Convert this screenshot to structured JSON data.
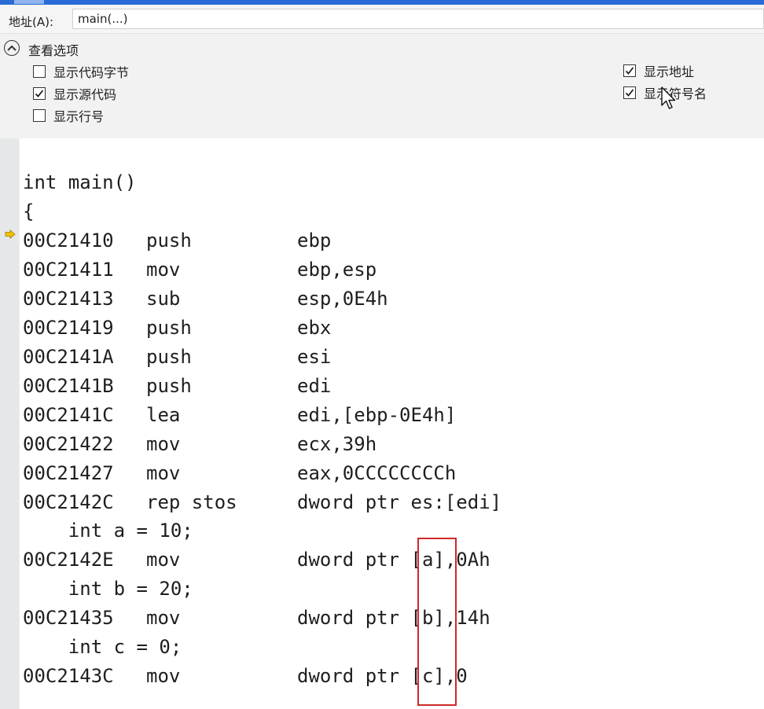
{
  "address": {
    "label": "地址(A):",
    "value": "main(...)"
  },
  "view_options": {
    "title": "查看选项",
    "left": [
      {
        "label": "显示代码字节",
        "checked": false
      },
      {
        "label": "显示源代码",
        "checked": true
      },
      {
        "label": "显示行号",
        "checked": false
      }
    ],
    "right": [
      {
        "label": "显示地址",
        "checked": true
      },
      {
        "label": "显示符号名",
        "checked": true
      }
    ]
  },
  "code": {
    "source_header": [
      "int main()",
      "{"
    ],
    "block1": [
      {
        "addr": "00C21410",
        "op": "push",
        "args": "ebp"
      },
      {
        "addr": "00C21411",
        "op": "mov",
        "args": "ebp,esp"
      },
      {
        "addr": "00C21413",
        "op": "sub",
        "args": "esp,0E4h"
      },
      {
        "addr": "00C21419",
        "op": "push",
        "args": "ebx"
      },
      {
        "addr": "00C2141A",
        "op": "push",
        "args": "esi"
      },
      {
        "addr": "00C2141B",
        "op": "push",
        "args": "edi"
      },
      {
        "addr": "00C2141C",
        "op": "lea",
        "args": "edi,[ebp-0E4h]"
      },
      {
        "addr": "00C21422",
        "op": "mov",
        "args": "ecx,39h"
      },
      {
        "addr": "00C21427",
        "op": "mov",
        "args": "eax,0CCCCCCCCh"
      },
      {
        "addr": "00C2142C",
        "op": "rep stos",
        "args": "dword ptr es:[edi]"
      }
    ],
    "src_a": "    int a = 10;",
    "instr_a": {
      "addr": "00C2142E",
      "op": "mov",
      "args": "dword ptr [a],0Ah"
    },
    "src_b": "    int b = 20;",
    "instr_b": {
      "addr": "00C21435",
      "op": "mov",
      "args": "dword ptr [b],14h"
    },
    "src_c": "    int c = 0;",
    "instr_c": {
      "addr": "00C2143C",
      "op": "mov",
      "args": "dword ptr [c],0"
    }
  },
  "colors": {
    "annotation_box": "#cc2a2a",
    "current_instruction_arrow": "#f2c200"
  }
}
